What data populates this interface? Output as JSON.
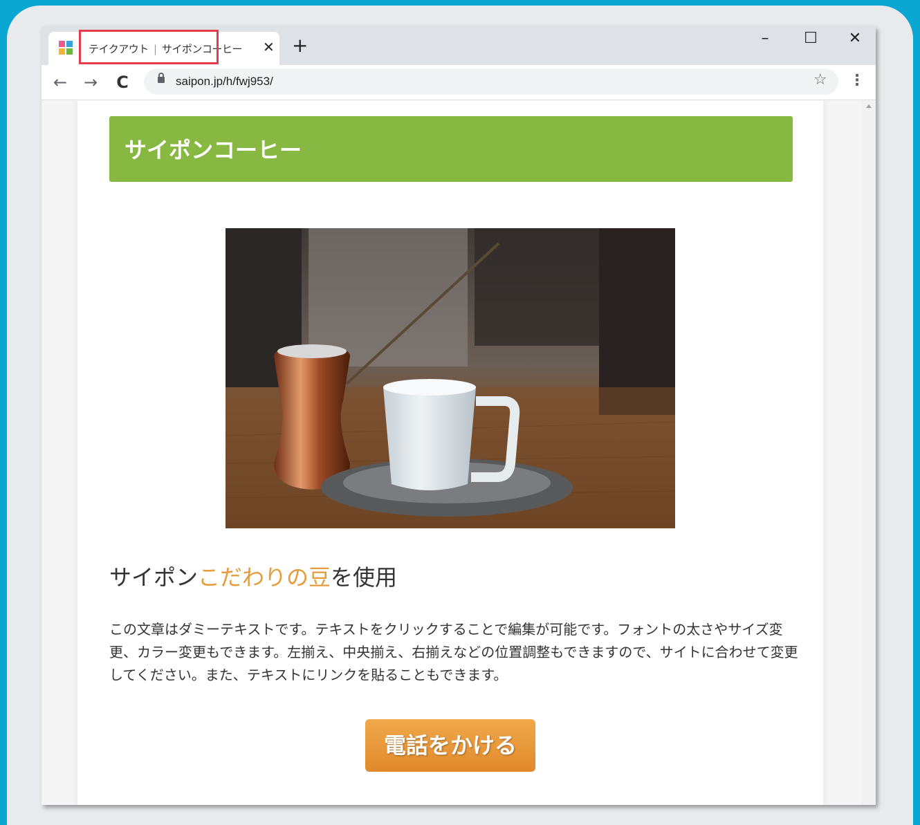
{
  "browser": {
    "tab": {
      "title_part1": "テイクアウト",
      "title_sep": "|",
      "title_part2": "サイポンコーヒー",
      "close_glyph": "✕"
    },
    "new_tab_glyph": "+",
    "window_controls": {
      "minimize": "–",
      "maximize": "☐",
      "close": "✕"
    },
    "toolbar": {
      "back_glyph": "←",
      "forward_glyph": "→",
      "reload_glyph": "C",
      "url": "saipon.jp/h/fwj953/",
      "bookmark_glyph": "☆",
      "menu_glyph": "⋮"
    },
    "highlight_color": "#e23b4a"
  },
  "page": {
    "site_title": "サイポンコーヒー",
    "header_color": "#86b842",
    "headline": {
      "before": "サイポン",
      "accent": "こだわりの豆",
      "after": "を使用",
      "accent_color": "#e59c3c"
    },
    "body_text": "この文章はダミーテキストです。テキストをクリックすることで編集が可能です。フォントの太さやサイズ変更、カラー変更もできます。左揃え、中央揃え、右揃えなどの位置調整もできますので、サイトに合わせて変更してください。また、テキストにリンクを貼ることもできます。",
    "call_button_label": "電話をかける",
    "call_button_color": "#e8962f"
  }
}
